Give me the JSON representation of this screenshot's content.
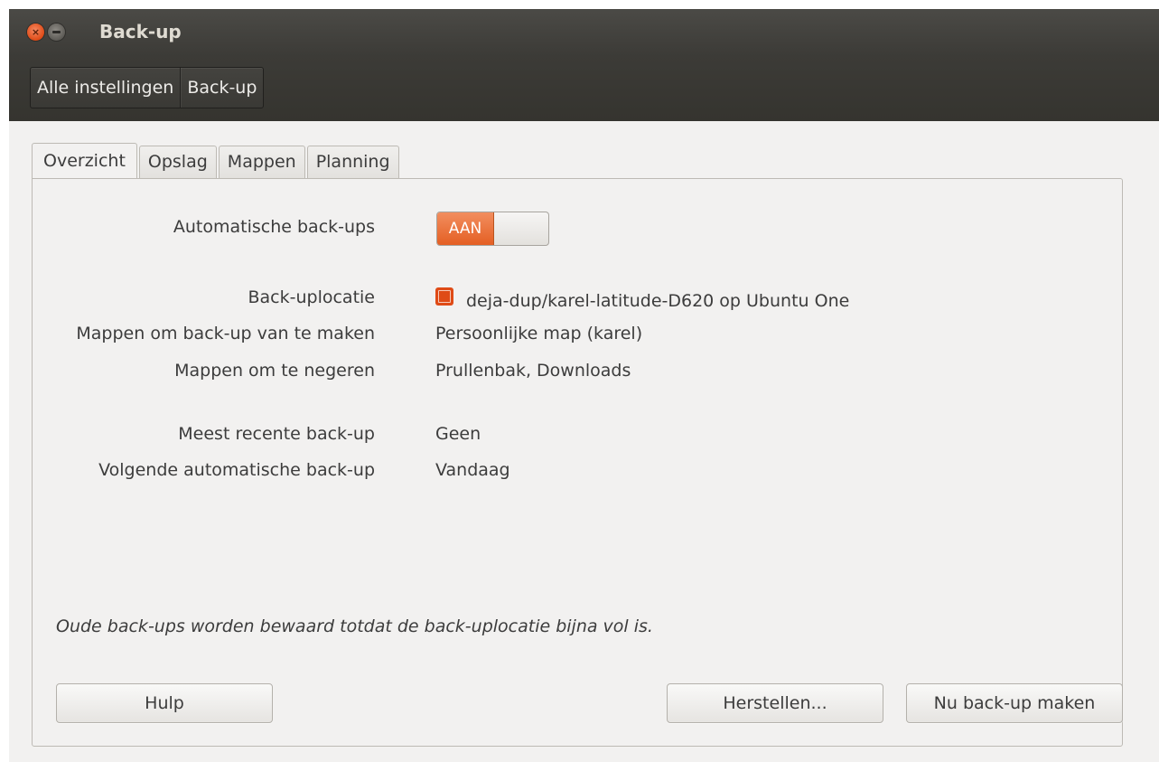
{
  "window": {
    "title": "Back-up"
  },
  "breadcrumb": {
    "items": [
      "Alle instellingen",
      "Back-up"
    ]
  },
  "tabs": [
    {
      "label": "Overzicht",
      "active": true
    },
    {
      "label": "Opslag",
      "active": false
    },
    {
      "label": "Mappen",
      "active": false
    },
    {
      "label": "Planning",
      "active": false
    }
  ],
  "overview": {
    "auto_backup_label": "Automatische back-ups",
    "auto_backup_toggle": "AAN",
    "location_label": "Back-uplocatie",
    "location_value": "deja-dup/karel-latitude-D620 op Ubuntu One",
    "location_icon": "ubuntu-one-icon",
    "include_label": "Mappen om back-up van te maken",
    "include_value": "Persoonlijke map (karel)",
    "exclude_label": "Mappen om te negeren",
    "exclude_value": "Prullenbak, Downloads",
    "last_backup_label": "Meest recente back-up",
    "last_backup_value": "Geen",
    "next_backup_label": "Volgende automatische back-up",
    "next_backup_value": "Vandaag",
    "note": "Oude back-ups worden bewaard totdat de back-uplocatie bijna vol is."
  },
  "buttons": {
    "help": "Hulp",
    "restore": "Herstellen...",
    "backup_now": "Nu back-up maken"
  },
  "colors": {
    "accent": "#e45f23",
    "titlebar": "#3c3b37",
    "background": "#f2f1f0"
  }
}
